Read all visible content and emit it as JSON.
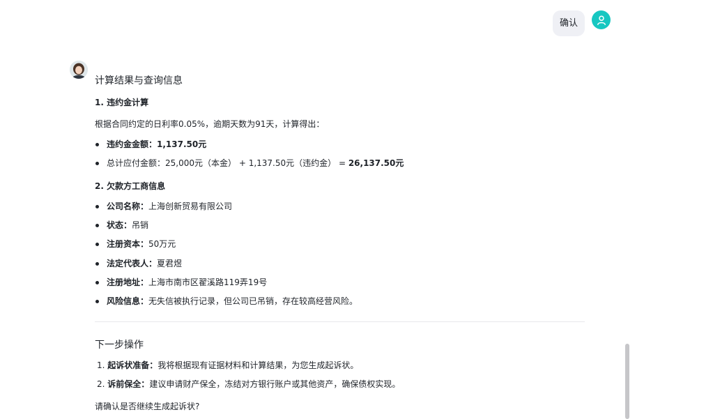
{
  "user_message": "确认",
  "reply": {
    "heading": "计算结果与查询信息",
    "section1_title": "1. 违约金计算",
    "section1_intro": "根据合同约定的日利率0.05%，逾期天数为91天，计算得出：",
    "penalty": {
      "label": "违约金金额：",
      "value": "1,137.50元"
    },
    "total": {
      "label": "总计应付金额：",
      "expr": "25,000元（本金） + 1,137.50元（违约金） = ",
      "value": "26,137.50元"
    },
    "section2_title": "2. 欠款方工商信息",
    "company_info": [
      {
        "label": "公司名称",
        "value": "上海创新贸易有限公司"
      },
      {
        "label": "状态",
        "value": "吊销"
      },
      {
        "label": "注册资本",
        "value": "50万元"
      },
      {
        "label": "法定代表人",
        "value": "夏君煜"
      },
      {
        "label": "注册地址",
        "value": "上海市南市区翟溪路119弄19号"
      },
      {
        "label": "风险信息",
        "value": "无失信被执行记录，但公司已吊销，存在较高经营风险。"
      }
    ],
    "next_heading": "下一步操作",
    "next_steps": [
      {
        "num": "1.",
        "label": "起诉状准备",
        "value": "我将根据现有证据材料和计算结果，为您生成起诉状。"
      },
      {
        "num": "2.",
        "label": "诉前保全",
        "value": "建议申请财产保全，冻结对方银行账户或其他资产，确保债权实现。"
      }
    ],
    "closing_question": "请确认是否继续生成起诉状?"
  },
  "colors": {
    "text": "#1f2329",
    "user_bubble": "#eff0f5",
    "user_avatar": "#17c7c1"
  },
  "icons": {
    "user_avatar": "user-icon",
    "bot_avatar": "assistant-avatar"
  }
}
